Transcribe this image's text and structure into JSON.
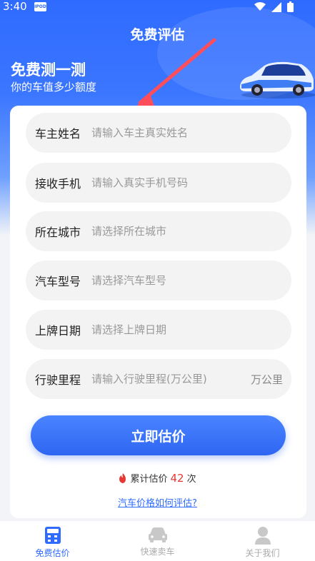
{
  "status_bar": {
    "time": "3:40",
    "app_badge": "IPOD"
  },
  "page_title": "免费评估",
  "hero": {
    "title": "免费测一测",
    "subtitle": "你的车值多少额度"
  },
  "form": {
    "fields": [
      {
        "label": "车主姓名",
        "placeholder": "请输入车主真实姓名",
        "value": ""
      },
      {
        "label": "接收手机",
        "placeholder": "请输入真实手机号码",
        "value": ""
      },
      {
        "label": "所在城市",
        "placeholder": "请选择所在城市",
        "value": ""
      },
      {
        "label": "汽车型号",
        "placeholder": "请选择汽车型号",
        "value": ""
      },
      {
        "label": "上牌日期",
        "placeholder": "请选择上牌日期",
        "value": ""
      },
      {
        "label": "行驶里程",
        "placeholder": "请输入行驶里程(万公里)",
        "value": "",
        "unit": "万公里"
      }
    ],
    "submit_label": "立即估价"
  },
  "counter": {
    "prefix": "累计估价",
    "count": "42",
    "suffix": "次"
  },
  "help_link": "汽车价格如何评估?",
  "tabbar": {
    "items": [
      {
        "label": "免费估价",
        "icon": "calculator-icon",
        "active": true
      },
      {
        "label": "快速卖车",
        "icon": "car-icon",
        "active": false
      },
      {
        "label": "关于我们",
        "icon": "user-icon",
        "active": false
      }
    ]
  },
  "colors": {
    "primary": "#2f6bff",
    "accent_red": "#e53935",
    "arrow_red": "#ff4d5a"
  }
}
